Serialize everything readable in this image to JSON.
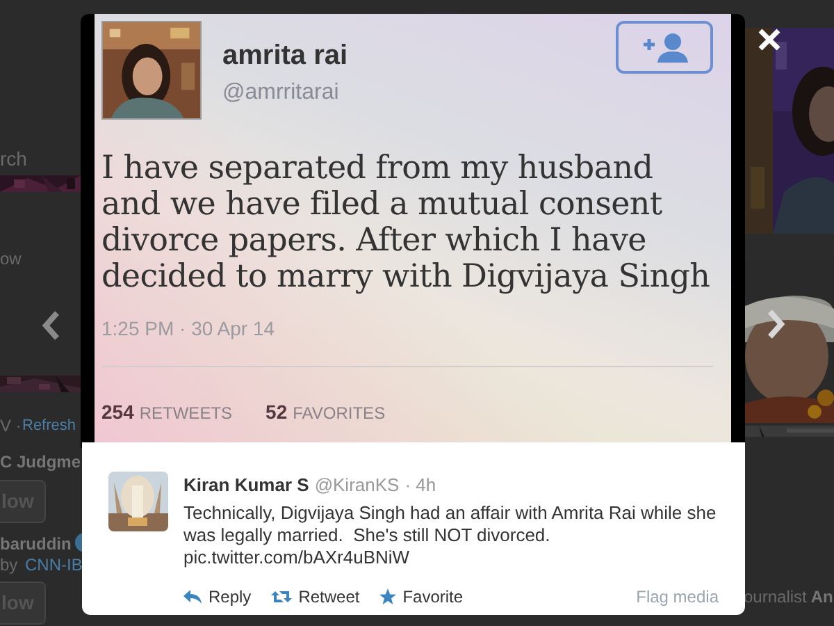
{
  "background": {
    "left": [
      {
        "kind": "text",
        "text": "rch"
      },
      {
        "kind": "text",
        "text": "ow"
      },
      {
        "kind": "text",
        "text": "V ·"
      },
      {
        "kind": "link",
        "text": "Refresh"
      },
      {
        "kind": "bold",
        "text": "C Judgme"
      },
      {
        "kind": "button",
        "text": "low"
      },
      {
        "kind": "bold",
        "text": "baruddin"
      },
      {
        "kind": "text",
        "text": "by"
      },
      {
        "kind": "link",
        "text": "CNN-IB"
      },
      {
        "kind": "button",
        "text": "low"
      }
    ],
    "right": [
      {
        "kind": "text",
        "text": "ournalist"
      },
      {
        "kind": "bold",
        "text": "An"
      }
    ]
  },
  "media": {
    "tweet": {
      "name": "amrita rai",
      "handle": "@amrritarai",
      "text": "I have separated from my husband\nand we have filed a mutual consent\ndivorce papers. After which I have\ndecided to marry with Digvijaya Singh",
      "time": "1:25 PM · 30 Apr 14",
      "stats": [
        {
          "count": "254",
          "label": "RETWEETS"
        },
        {
          "count": "52",
          "label": "FAVORITES"
        }
      ]
    }
  },
  "card": {
    "name": "Kiran Kumar S",
    "handle": "@KiranKS",
    "time": "· 4h",
    "text": "Technically, Digvijaya Singh had an affair with Amrita Rai while she was legally married.  She's still NOT divorced.",
    "link": "pic.twitter.com/bAXr4uBNiW",
    "actions": [
      {
        "kind": "reply",
        "label": "Reply"
      },
      {
        "kind": "retweet",
        "label": "Retweet"
      },
      {
        "kind": "favorite",
        "label": "Favorite"
      }
    ],
    "flag": "Flag media"
  }
}
